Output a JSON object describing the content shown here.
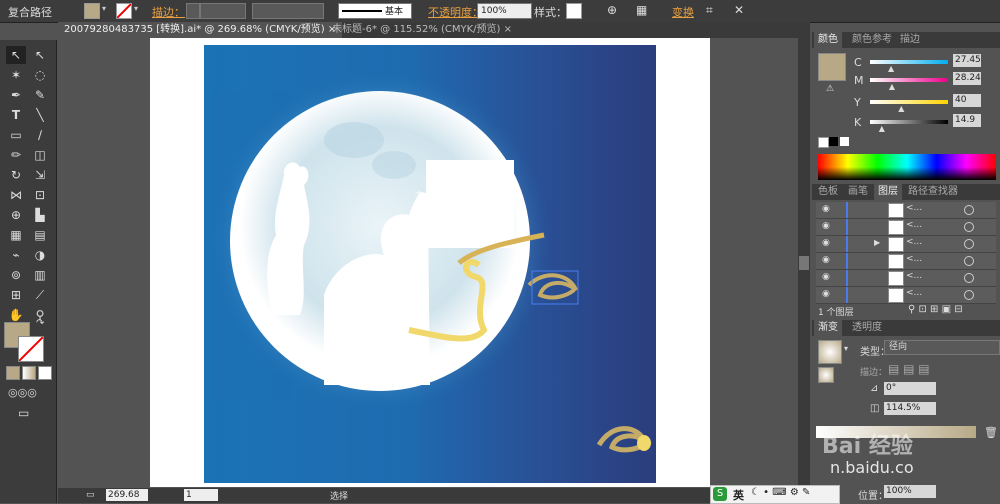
{
  "control_bar": {
    "object_type": "复合路径",
    "stroke_label": "描边：",
    "stroke_profile": "基本",
    "opacity_label": "不透明度：",
    "opacity_value": "100%",
    "style_label": "样式：",
    "transform_label": "变换"
  },
  "tabs": [
    {
      "label": "20079280483735 [转换].ai* @ 269.68% (CMYK/预览)",
      "close": "×"
    },
    {
      "label": "未标题-6* @ 115.52% (CMYK/预览)",
      "close": "×"
    }
  ],
  "status_bar": {
    "zoom": "269.68",
    "page": "1",
    "tool": "选择"
  },
  "color_panel": {
    "tabs": [
      "颜色",
      "颜色参考",
      "描边"
    ],
    "channels": [
      {
        "label": "C",
        "value": "27.45"
      },
      {
        "label": "M",
        "value": "28.24"
      },
      {
        "label": "Y",
        "value": "40"
      },
      {
        "label": "K",
        "value": "14.9"
      }
    ],
    "channel_levels": [
      0.27,
      0.28,
      0.4,
      0.15
    ],
    "fill_color": "#b8a986"
  },
  "layers_panel": {
    "tabs": [
      "色板",
      "画笔",
      "图层",
      "路径查找器"
    ],
    "row_label": "<...",
    "row_count": 6,
    "footer": "1 个图层"
  },
  "gradient_panel": {
    "tabs": [
      "渐变",
      "透明度"
    ],
    "type_label": "类型：",
    "type_value": "径向",
    "stroke_label": "描边：",
    "angle_value": "0°",
    "aspect_value": "114.5%",
    "location_label": "位置：",
    "location_value": "100%"
  },
  "watermark": {
    "line1": "Bai 经验",
    "line2": "n.baidu.co"
  },
  "ime_bar": {
    "lang": "英"
  }
}
